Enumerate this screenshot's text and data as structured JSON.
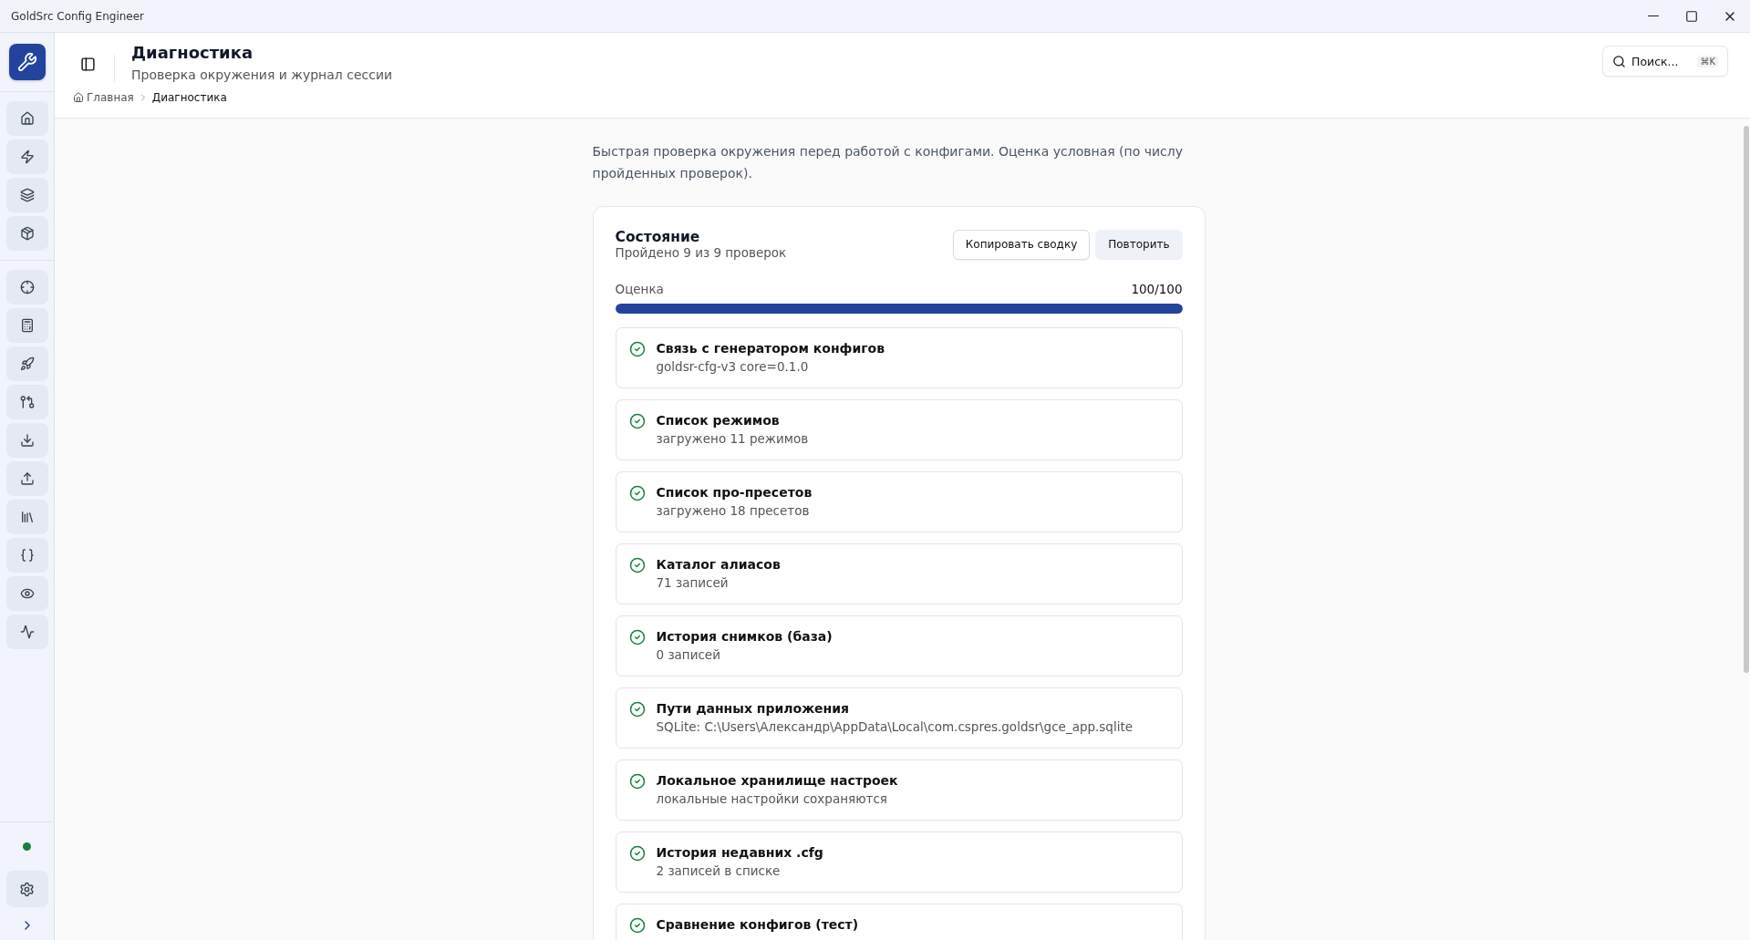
{
  "window": {
    "title": "GoldSrc Config Engineer"
  },
  "header": {
    "title": "Диагностика",
    "subtitle": "Проверка окружения и журнал сессии",
    "search": {
      "placeholder": "Поиск...",
      "shortcut": "⌘K"
    }
  },
  "breadcrumbs": [
    {
      "label": "Главная",
      "kind": "home"
    },
    {
      "label": "Диагностика",
      "kind": "current"
    }
  ],
  "intro": "Быстрая проверка окружения перед работой с конфигами. Оценка условная (по числу пройденных проверок).",
  "status": {
    "title": "Состояние",
    "summary": "Пройдено 9 из 9 проверок",
    "buttons": [
      {
        "label": "Копировать сводку",
        "kind": "outline"
      },
      {
        "label": "Повторить",
        "kind": "soft"
      }
    ],
    "score_label": "Оценка",
    "score": "100/100",
    "level": 1
  },
  "checks": [
    {
      "title": "Связь с генератором конфигов",
      "detail": "goldsr-cfg-v3 core=0.1.0",
      "passed": true
    },
    {
      "title": "Список режимов",
      "detail": "загружено 11 режимов",
      "passed": true
    },
    {
      "title": "Список про-пресетов",
      "detail": "загружено 18 пресетов",
      "passed": true
    },
    {
      "title": "Каталог алиасов",
      "detail": "71 записей",
      "passed": true
    },
    {
      "title": "История снимков (база)",
      "detail": "0 записей",
      "passed": true
    },
    {
      "title": "Пути данных приложения",
      "detail": "SQLite: C:\\Users\\Александр\\AppData\\Local\\com.cspres.goldsr\\gce_app.sqlite",
      "passed": true
    },
    {
      "title": "Локальное хранилище настроек",
      "detail": "локальные настройки сохраняются",
      "passed": true
    },
    {
      "title": "История недавних .cfg",
      "detail": "2 записей в списке",
      "passed": true
    },
    {
      "title": "Сравнение конфигов (тест)",
      "passed": true
    }
  ],
  "connection": {
    "online": true
  }
}
